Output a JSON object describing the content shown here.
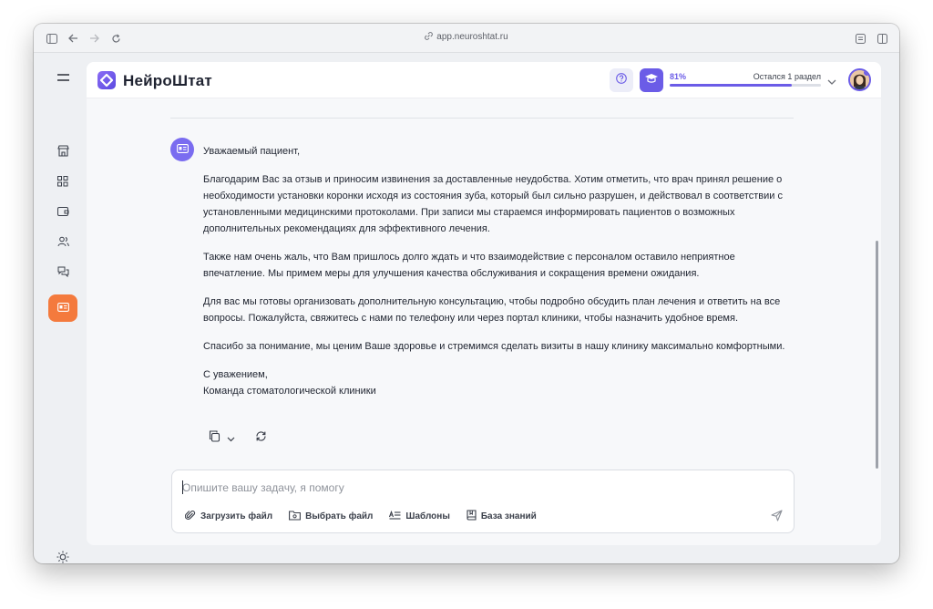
{
  "browser": {
    "url": "app.neuroshtat.ru"
  },
  "header": {
    "brand": "НейроШтат",
    "progress_percent_label": "81%",
    "progress_value": 0.81,
    "progress_remaining": "Остался 1 раздел",
    "accent_color": "#6b5ce7"
  },
  "sidebar": {
    "items": [
      {
        "icon": "menu-icon"
      },
      {
        "icon": "store-icon"
      },
      {
        "icon": "grid-icon"
      },
      {
        "icon": "wallet-icon"
      },
      {
        "icon": "users-icon"
      },
      {
        "icon": "chat-icon"
      },
      {
        "icon": "id-card-icon",
        "active": true
      },
      {
        "icon": "sun-icon"
      }
    ],
    "active_color": "#f47a3d"
  },
  "message": {
    "greeting": "Уважаемый пациент,",
    "paragraphs": [
      "Благодарим Вас за отзыв и приносим извинения за доставленные неудобства. Хотим отметить, что врач принял решение о необходимости установки коронки исходя из состояния зуба, который был сильно разрушен, и действовал в соответствии с установленными медицинскими протоколами. При записи мы стараемся информировать пациентов о возможных дополнительных рекомендациях для эффективного лечения.",
      "Также нам очень жаль, что Вам пришлось долго ждать и что взаимодействие с персоналом оставило неприятное впечатление. Мы примем меры для улучшения качества обслуживания и сокращения времени ожидания.",
      "Для вас мы готовы организовать дополнительную консультацию, чтобы подробно обсудить план лечения и ответить на все вопросы. Пожалуйста, свяжитесь с нами по телефону или через портал клиники, чтобы назначить удобное время.",
      "Спасибо за понимание, мы ценим Ваше здоровье и стремимся сделать визиты в нашу клинику максимально комфортными."
    ],
    "signoff_line1": "С уважением,",
    "signoff_line2": "Команда стоматологической клиники"
  },
  "composer": {
    "placeholder": "Опишите вашу задачу, я помогу",
    "value": "",
    "tools": {
      "upload": "Загрузить файл",
      "choose": "Выбрать файл",
      "templates": "Шаблоны",
      "knowledge": "База знаний"
    }
  }
}
